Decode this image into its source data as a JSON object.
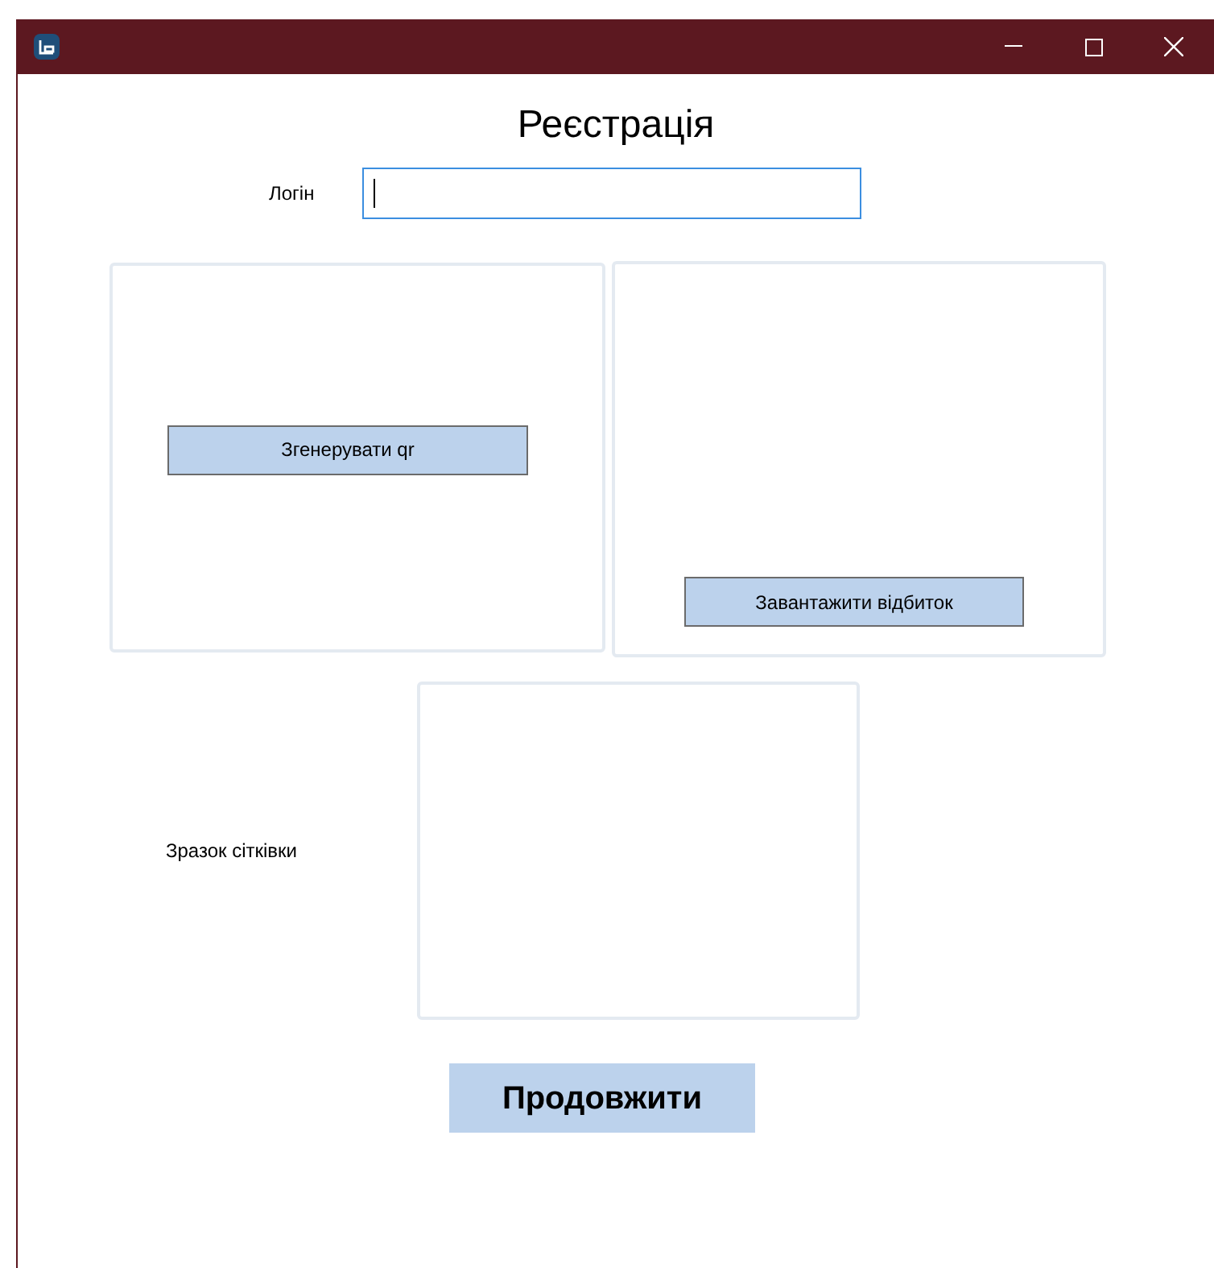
{
  "window": {
    "title_bar": {
      "buttons": [
        {
          "kind": "minimize"
        },
        {
          "kind": "maximize"
        },
        {
          "kind": "close"
        }
      ]
    }
  },
  "heading": "Реєстрація",
  "login": {
    "label": "Логін",
    "focused": true
  },
  "qr_panel": {
    "button": "Згенерувати qr"
  },
  "fingerprint_panel": {
    "button": "Завантажити відбиток"
  },
  "retina": {
    "label": "Зразок сітківки"
  },
  "continue_button": "Продовжити"
}
